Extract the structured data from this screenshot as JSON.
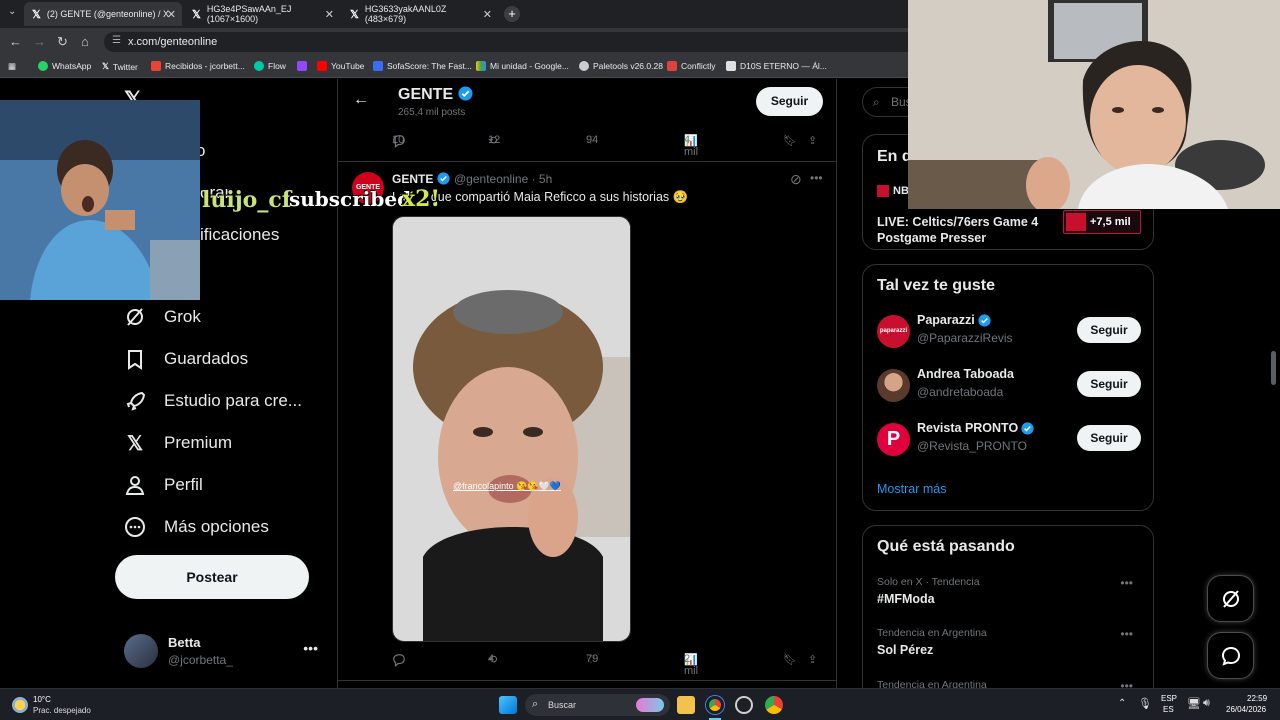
{
  "browser": {
    "tabs": [
      {
        "label": "(2) GENTE (@genteonline) / X"
      },
      {
        "label": "HG3e4PSawAAn_EJ (1067×1600)"
      },
      {
        "label": "HG3633yakAANL0Z (483×679)"
      }
    ],
    "url": "x.com/genteonline",
    "bookmarks": [
      {
        "label": "WhatsApp",
        "color": "#25d366"
      },
      {
        "label": "Twitter",
        "color": "#ffffff"
      },
      {
        "label": "Recibidos - jcorbett...",
        "color": "#ea4335"
      },
      {
        "label": "Flow",
        "color": "#00c9a7"
      },
      {
        "label": "YouTube",
        "color": "#ff0000"
      },
      {
        "label": "SofaScore: The Fast...",
        "color": "#3b6cf6"
      },
      {
        "label": "Mi unidad - Google...",
        "color": "#fbbc04"
      },
      {
        "label": "Paletools v26.0.28",
        "color": "#cccccc"
      },
      {
        "label": "Conflictly",
        "color": "#e04040"
      },
      {
        "label": "D10S ETERNO — Ál...",
        "color": "#e0e0e0"
      }
    ]
  },
  "sidebar": {
    "partial_items": [
      "o",
      "orar",
      "ificaciones"
    ],
    "items": [
      {
        "label": "Grok",
        "icon": "grok-icon"
      },
      {
        "label": "Guardados",
        "icon": "bookmark-icon"
      },
      {
        "label": "Estudio para cre...",
        "icon": "rocket-icon"
      },
      {
        "label": "Premium",
        "icon": "x-logo-icon"
      },
      {
        "label": "Perfil",
        "icon": "person-icon"
      },
      {
        "label": "Más opciones",
        "icon": "more-icon"
      }
    ],
    "post_button": "Postear",
    "profile": {
      "name": "Betta",
      "handle": "@jcorbetta_"
    }
  },
  "header": {
    "name": "GENTE",
    "posts": "265,4 mil posts",
    "follow": "Seguir"
  },
  "prev_post_actions": {
    "replies": "10",
    "reposts": "12",
    "likes": "94",
    "views": "4 mil"
  },
  "post": {
    "name": "GENTE",
    "handle": "@genteonline · 5h",
    "text_start": "La f",
    "text_end": "que compartió Maia Reficco a sus historias 🥹",
    "avatar_label": "GENTE",
    "media_mention": "@francolapinto 😘😘🤍💙",
    "actions": {
      "replies": "",
      "reposts": "4",
      "likes": "79",
      "views": "2 mil"
    }
  },
  "right": {
    "search_placeholder": "Bus",
    "trending_title_partial": "En d",
    "live_source": "NB",
    "live_title": "LIVE: Celtics/76ers Game 4 Postgame Presser",
    "live_count": "+7,5 mil",
    "suggestions_title": "Tal vez te guste",
    "suggestions": [
      {
        "name": "Paparazzi",
        "handle": "@PaparazziRevis",
        "verified": true,
        "color": "#c8102e",
        "avatar_text": "paparazzi"
      },
      {
        "name": "Andrea Taboada",
        "handle": "@andretaboada",
        "verified": false,
        "color": "#6b4a3a",
        "avatar_text": ""
      },
      {
        "name": "Revista PRONTO",
        "handle": "@Revista_PRONTO",
        "verified": true,
        "color": "#e0003c",
        "avatar_text": "P"
      }
    ],
    "follow_label": "Seguir",
    "show_more": "Mostrar más",
    "happening_title": "Qué está pasando",
    "trends": [
      {
        "meta": "Solo en X · Tendencia",
        "title": "#MFModa"
      },
      {
        "meta": "Tendencia en Argentina",
        "title": "Sol Pérez"
      },
      {
        "meta": "Tendencia en Argentina",
        "title": ""
      }
    ]
  },
  "overlay": {
    "username": "luijo_cf",
    "subscribed": "subscribed",
    "multiplier": "x2!"
  },
  "taskbar": {
    "temp": "10°C",
    "weather": "Prac. despejado",
    "search": "Buscar",
    "lang1": "ESP",
    "lang2": "ES",
    "time": "22:59",
    "date": "26/04/2026"
  }
}
